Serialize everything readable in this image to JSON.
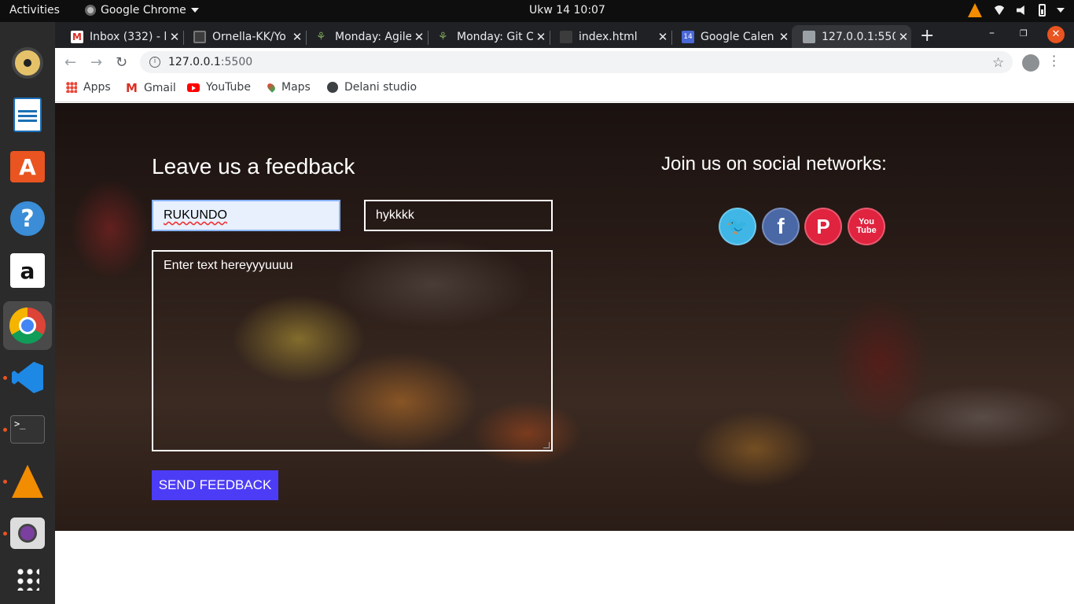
{
  "system": {
    "activities": "Activities",
    "app_name": "Google Chrome",
    "clock": "Ukw 14  10:07"
  },
  "tabs": [
    {
      "label": "Inbox (332) - l",
      "icon": "gmail-icon"
    },
    {
      "label": "Ornella-KK/Yo",
      "icon": "github-icon"
    },
    {
      "label": "Monday: Agile",
      "icon": "palm-icon"
    },
    {
      "label": "Monday: Git C",
      "icon": "palm-icon"
    },
    {
      "label": "index.html",
      "icon": "page-icon"
    },
    {
      "label": "Google Calen",
      "icon": "calendar-icon"
    },
    {
      "label": "127.0.0.1:5500",
      "icon": "globe-icon"
    }
  ],
  "calendar_favicon_day": "14",
  "omnibox": {
    "host": "127.0.0.1",
    "port": ":5500"
  },
  "bookmarks": {
    "apps": "Apps",
    "gmail": "Gmail",
    "youtube": "YouTube",
    "maps": "Maps",
    "delani": "Delani studio"
  },
  "feedback": {
    "title": "Leave us a feedback",
    "name_value": "RUKUNDO",
    "email_value": "hykkkk",
    "message_value": "Enter text hereyyyuuuu",
    "send_label": "SEND FEEDBACK"
  },
  "social": {
    "title": "Join us on social networks:",
    "youtube_line1": "You",
    "youtube_line2": "Tube"
  },
  "colors": {
    "send_button": "#4d3cf6",
    "twitter": "#3fb6e6",
    "facebook": "#4a67a6",
    "pinterest": "#e0233f",
    "youtube": "#e0233f",
    "ubuntu_orange": "#e95420"
  }
}
